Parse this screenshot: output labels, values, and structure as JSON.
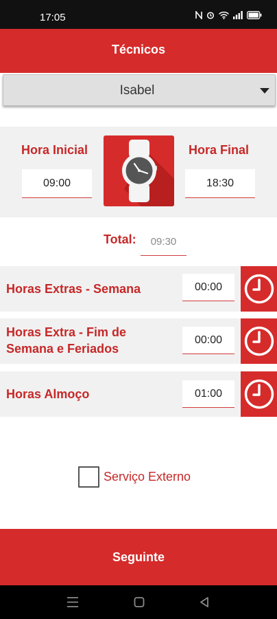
{
  "status_bar": {
    "time": "17:05",
    "icons": [
      "nfc-icon",
      "alarm-icon",
      "wifi-icon",
      "signal-icon",
      "battery-icon"
    ]
  },
  "app_bar": {
    "title": "Técnicos"
  },
  "technician_select": {
    "selected": "Isabel"
  },
  "hours": {
    "start_label": "Hora Inicial",
    "start_value": "09:00",
    "end_label": "Hora Final",
    "end_value": "18:30",
    "watch_icon": "wristwatch-icon"
  },
  "total": {
    "label": "Total:",
    "value": "09:30"
  },
  "extras": [
    {
      "label": "Horas Extras - Semana",
      "value": "00:00",
      "icon": "clock-icon"
    },
    {
      "label": "Horas Extra - Fim de Semana e Feriados",
      "value": "00:00",
      "icon": "clock-icon"
    },
    {
      "label": "Horas Almoço",
      "value": "01:00",
      "icon": "clock-icon"
    }
  ],
  "external_service": {
    "label": "Serviço Externo",
    "checked": false
  },
  "next_button": {
    "label": "Seguinte"
  },
  "nav_bar": {
    "buttons": [
      "menu-icon",
      "home-icon",
      "back-icon"
    ]
  },
  "colors": {
    "accent": "#d62b2b",
    "label_red": "#c62828",
    "panel_bg": "#f1f1f1",
    "status_bar": "#111111"
  }
}
